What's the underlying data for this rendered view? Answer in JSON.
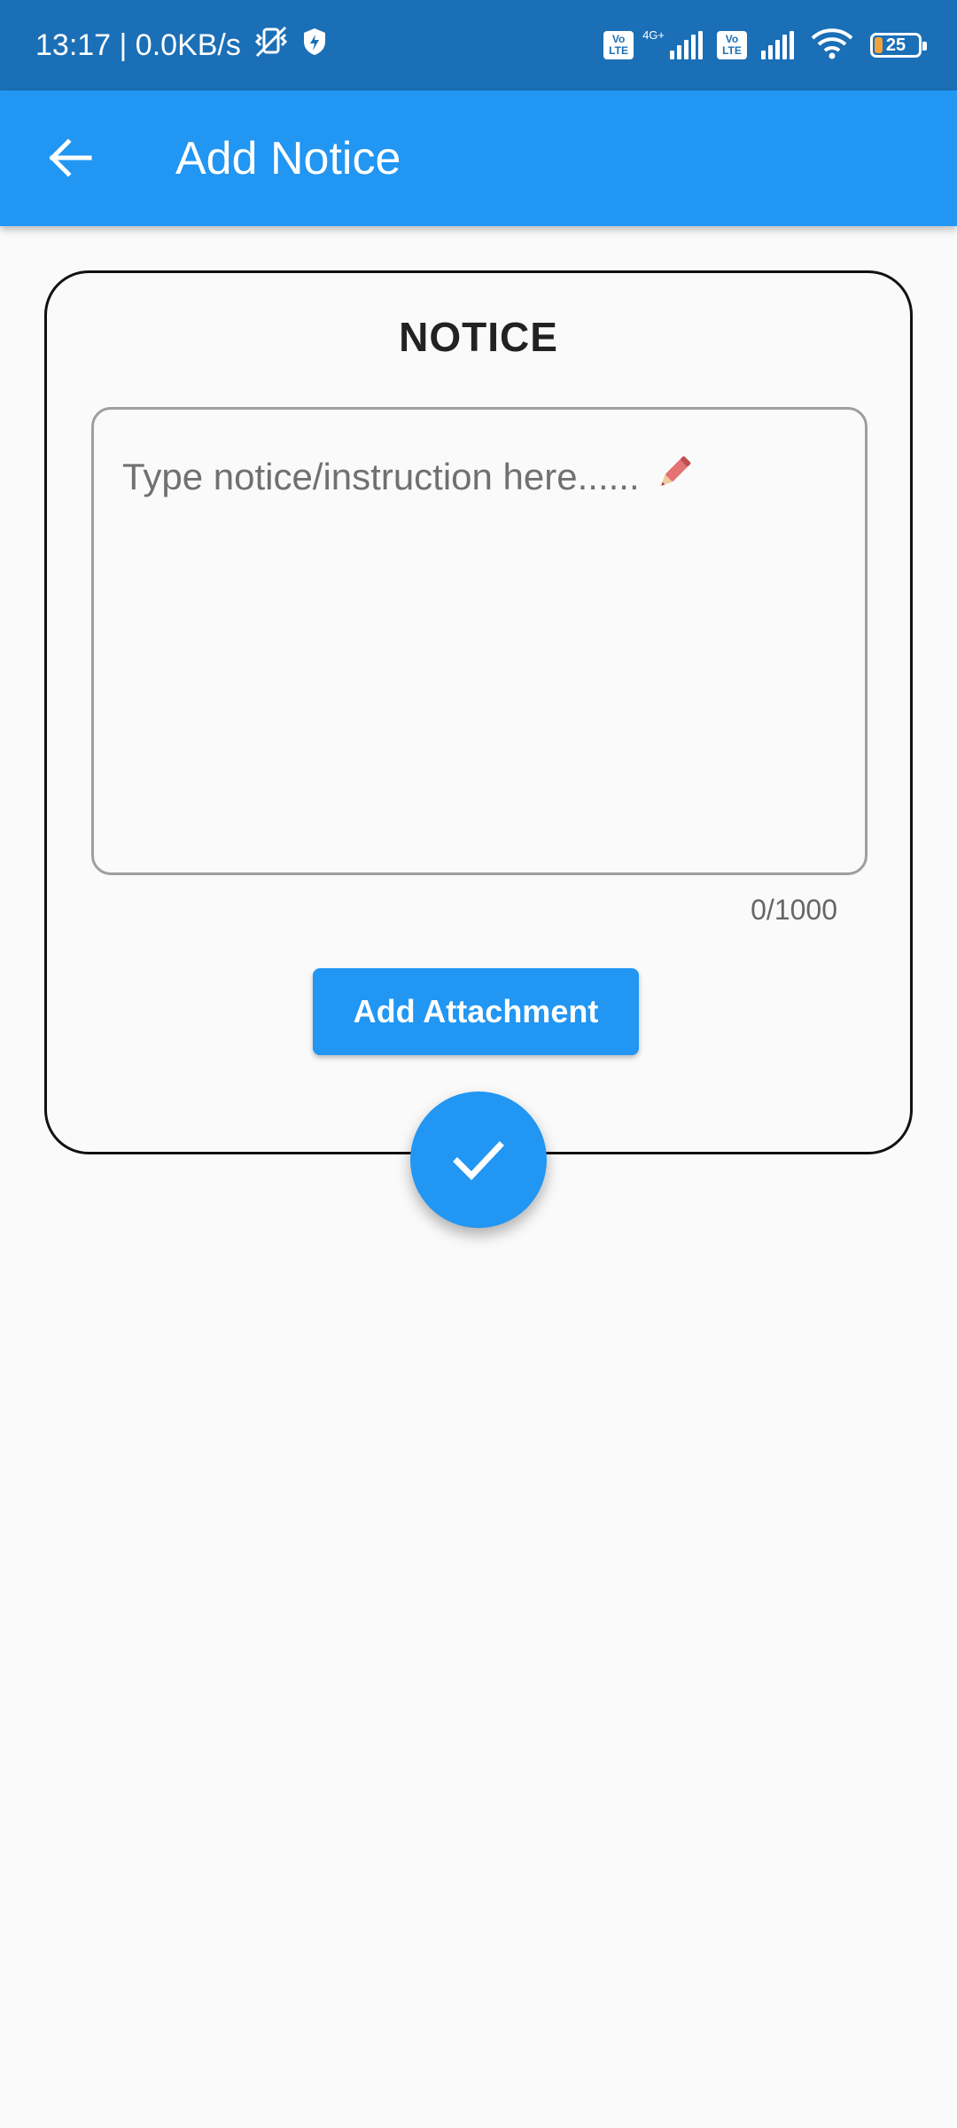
{
  "status_bar": {
    "time_speed": "13:17 | 0.0KB/s",
    "icons": [
      "vibrate-off-icon",
      "shield-bolt-icon",
      "volte-icon",
      "signal-4g-icon",
      "volte-icon",
      "signal-icon",
      "wifi-icon",
      "battery-icon"
    ],
    "volte_top": "Vo",
    "volte_bottom": "LTE",
    "network_label": "4G+",
    "battery_level": "25",
    "colors": {
      "background": "#1b6fb6",
      "battery_fill": "#f2a23b"
    }
  },
  "app_bar": {
    "title": "Add Notice",
    "back_icon": "arrow-back-icon",
    "color": "#2196f3"
  },
  "card": {
    "title": "NOTICE",
    "textarea": {
      "placeholder": "Type notice/instruction here......",
      "value": "",
      "icon": "pencil-icon"
    },
    "counter": "0/1000",
    "attachment_button_label": "Add Attachment"
  },
  "fab": {
    "icon": "check-icon",
    "color": "#2196f3"
  }
}
